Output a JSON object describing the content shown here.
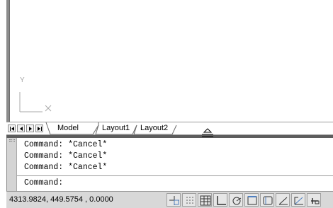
{
  "ucs": {
    "y_label": "Y",
    "x_label": "X"
  },
  "tabs": [
    {
      "label": "Model",
      "active": true
    },
    {
      "label": "Layout1",
      "active": false
    },
    {
      "label": "Layout2",
      "active": false
    }
  ],
  "command_window": {
    "history": [
      "Command: *Cancel*",
      "Command: *Cancel*",
      "Command: *Cancel*"
    ],
    "prompt": "Command:"
  },
  "status_bar": {
    "coordinates": "4313.9824, 449.5754 , 0.0000",
    "buttons": [
      "snap-icon",
      "grid-icon",
      "ortho-icon",
      "polar-icon",
      "osnap-icon",
      "otrack-icon",
      "ducs-icon",
      "dyn-icon",
      "lwt-icon"
    ]
  },
  "colors": {
    "splitter": "#5d5d5d",
    "status_bg": "#d8d8d8",
    "border": "#8c8c8c"
  }
}
